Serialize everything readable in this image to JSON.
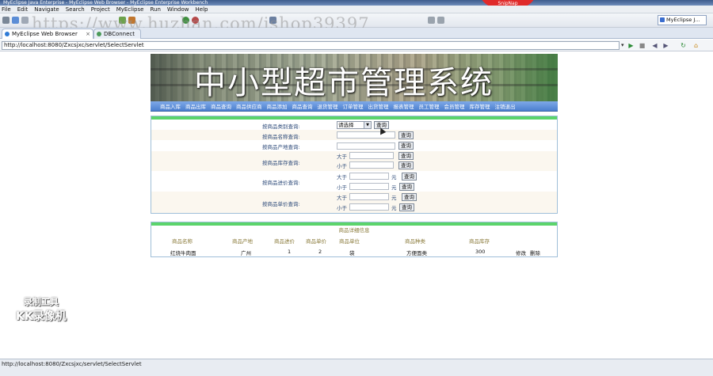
{
  "window": {
    "title": "MyEclipse Java Enterprise - MyEclipse Web Browser - MyEclipse Enterprise Workbench"
  },
  "snippet_badge": "SnipNap",
  "menu": [
    "File",
    "Edit",
    "Navigate",
    "Search",
    "Project",
    "MyEclipse",
    "Run",
    "Window",
    "Help"
  ],
  "perspective": "MyEclipse J...",
  "watermark_url": "https://www.huzhan.com/ishop39397",
  "tabs": [
    {
      "label": "MyEclipse Web Browser",
      "active": true
    },
    {
      "label": "DBConnect",
      "active": false
    }
  ],
  "address": "http://localhost:8080/Zxcsjxc/servlet/SelectServlet",
  "status": "http://localhost:8080/Zxcsjxc/servlet/SelectServlet",
  "recorder_watermark": {
    "line1": "录制工具",
    "line2": "KK录像机"
  },
  "site": {
    "title": "中小型超市管理系统",
    "nav": [
      "商品入库",
      "商品出库",
      "商品查询",
      "商品供应商",
      "商品添加",
      "商品查询",
      "退货管理",
      "订单管理",
      "出货管理",
      "报表管理",
      "员工管理",
      "会员管理",
      "库存管理",
      "注销退出"
    ]
  },
  "search": {
    "type_label": "按商品类别查询:",
    "type_select": "请选择",
    "name_label": "按商品名称查询:",
    "origin_label": "按商品产地查询:",
    "stock_label": "按商品库存查询:",
    "purchase_label": "按商品进价查询:",
    "sale_label": "按商品单价查询:",
    "greater": "大于",
    "less": "小于",
    "yuan": "元",
    "query_button": "查询"
  },
  "results": {
    "title": "商品详细信息",
    "headers": [
      "商品名称",
      "商品产地",
      "商品进价",
      "商品单价",
      "商品单位",
      "商品种类",
      "商品库存"
    ],
    "rows": [
      {
        "name": "红烧牛肉面",
        "origin": "广州",
        "purchase": "1",
        "price": "2",
        "unit": "袋",
        "category": "方便面类",
        "stock": "300",
        "edit": "修改",
        "delete": "删除"
      }
    ]
  }
}
